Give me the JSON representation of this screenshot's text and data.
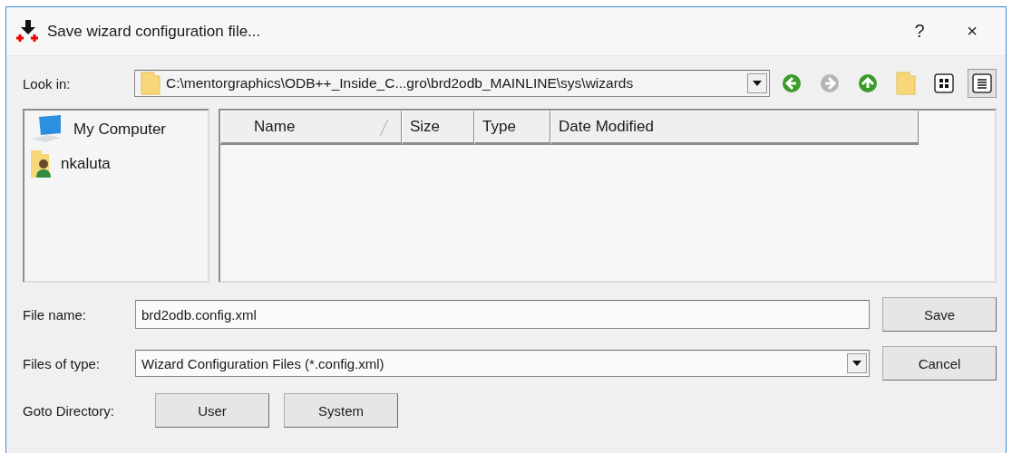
{
  "window": {
    "title": "Save wizard configuration file...",
    "help": "?",
    "close": "×"
  },
  "look_in": {
    "label": "Look in:",
    "value": "C:\\mentorgraphics\\ODB++_Inside_C...gro\\brd2odb_MAINLINE\\sys\\wizards"
  },
  "nav_buttons": [
    {
      "kind": "back",
      "disabled": false
    },
    {
      "kind": "forward",
      "disabled": true
    },
    {
      "kind": "up",
      "disabled": false
    },
    {
      "kind": "new-folder",
      "disabled": false
    }
  ],
  "view_modes": [
    {
      "kind": "list",
      "selected": false
    },
    {
      "kind": "details",
      "selected": true
    }
  ],
  "places": [
    {
      "kind": "computer",
      "label": "My Computer"
    },
    {
      "kind": "user",
      "label": "nkaluta"
    }
  ],
  "columns": [
    {
      "label": "Name",
      "sorted": true
    },
    {
      "label": "Size",
      "sorted": false
    },
    {
      "label": "Type",
      "sorted": false
    },
    {
      "label": "Date Modified",
      "sorted": false
    }
  ],
  "file_name": {
    "label": "File name:",
    "value": "brd2odb.config.xml"
  },
  "file_type": {
    "label": "Files of type:",
    "value": "Wizard Configuration Files (*.config.xml)"
  },
  "goto": {
    "label": "Goto Directory:",
    "buttons": [
      "User",
      "System"
    ]
  },
  "actions": [
    "Save",
    "Cancel"
  ]
}
